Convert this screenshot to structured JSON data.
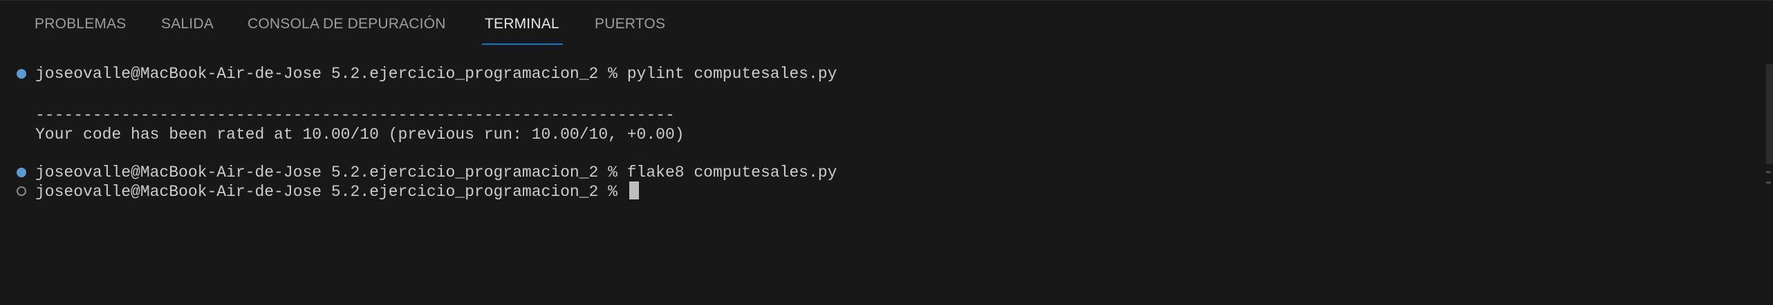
{
  "tabs": [
    {
      "label": "PROBLEMAS"
    },
    {
      "label": "SALIDA"
    },
    {
      "label": "CONSOLA DE DEPURACIÓN"
    },
    {
      "label": "TERMINAL",
      "active": true
    },
    {
      "label": "PUERTOS"
    }
  ],
  "terminal": {
    "lines": [
      {
        "text": "joseovalle@MacBook-Air-de-Jose 5.2.ejercicio_programacion_2 % pylint computesales.py",
        "decoration": "success"
      },
      {
        "text": ""
      },
      {
        "text": "-------------------------------------------------------------------"
      },
      {
        "text": "Your code has been rated at 10.00/10 (previous run: 10.00/10, +0.00)"
      },
      {
        "text": ""
      },
      {
        "text": "joseovalle@MacBook-Air-de-Jose 5.2.ejercicio_programacion_2 % flake8 computesales.py",
        "decoration": "success"
      },
      {
        "text": "joseovalle@MacBook-Air-de-Jose 5.2.ejercicio_programacion_2 % ",
        "decoration": "pending",
        "cursor": true
      }
    ]
  },
  "colors": {
    "background": "#181818",
    "accent": "#0078d4",
    "success_decoration": "#5b9bd0",
    "text": "#cccccc"
  }
}
